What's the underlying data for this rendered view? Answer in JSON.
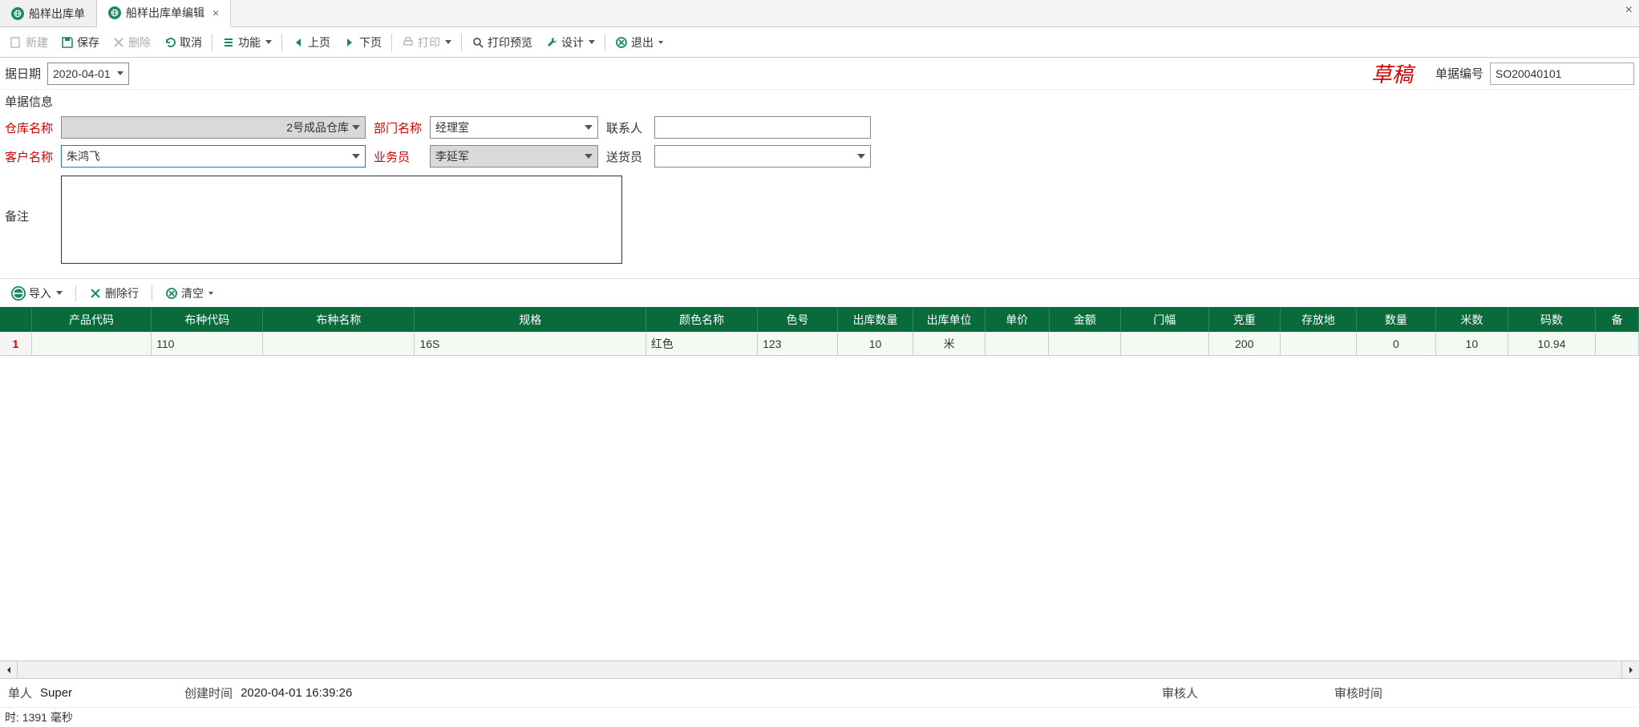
{
  "tabs": [
    {
      "label": "船样出库单",
      "active": false
    },
    {
      "label": "船样出库单编辑",
      "active": true
    }
  ],
  "toolbar": {
    "new": "新建",
    "save": "保存",
    "delete": "删除",
    "cancel": "取消",
    "function": "功能",
    "prev": "上页",
    "next": "下页",
    "print": "打印",
    "preview": "打印预览",
    "design": "设计",
    "exit": "退出"
  },
  "header": {
    "date_label": "据日期",
    "date_value": "2020-04-01",
    "status": "草稿",
    "docno_label": "单据编号",
    "docno_value": "SO20040101"
  },
  "form": {
    "section_title": "单据信息",
    "warehouse_label": "仓库名称",
    "warehouse_value": "2号成品仓库",
    "dept_label": "部门名称",
    "dept_value": "经理室",
    "contact_label": "联系人",
    "contact_value": "",
    "customer_label": "客户名称",
    "customer_value": "朱鸿飞",
    "clerk_label": "业务员",
    "clerk_value": "李延军",
    "delivery_label": "送货员",
    "delivery_value": "",
    "remark_label": "备注",
    "remark_value": ""
  },
  "grid_toolbar": {
    "import": "导入",
    "delete_row": "删除行",
    "clear": "清空"
  },
  "grid": {
    "columns": [
      "产品代码",
      "布种代码",
      "布种名称",
      "规格",
      "颜色名称",
      "色号",
      "出库数量",
      "出库单位",
      "单价",
      "金额",
      "门幅",
      "克重",
      "存放地",
      "数量",
      "米数",
      "码数",
      "备"
    ],
    "rows": [
      {
        "num": "1",
        "prodcode": "",
        "clothcode": "110",
        "clothname": "",
        "spec": "16S",
        "colorname": "红色",
        "colorno": "123",
        "outqty": "10",
        "outunit": "米",
        "price": "",
        "amount": "",
        "width": "",
        "weight": "200",
        "storage": "",
        "qty": "0",
        "meter": "10",
        "yard": "10.94",
        "remark": ""
      }
    ]
  },
  "statusbar": {
    "creator_label": "单人",
    "creator_value": "Super",
    "ctime_label": "创建时间",
    "ctime_value": "2020-04-01 16:39:26",
    "auditor_label": "审核人",
    "auditor_value": "",
    "atime_label": "审核时间",
    "atime_value": ""
  },
  "timing": "时: 1391 毫秒"
}
